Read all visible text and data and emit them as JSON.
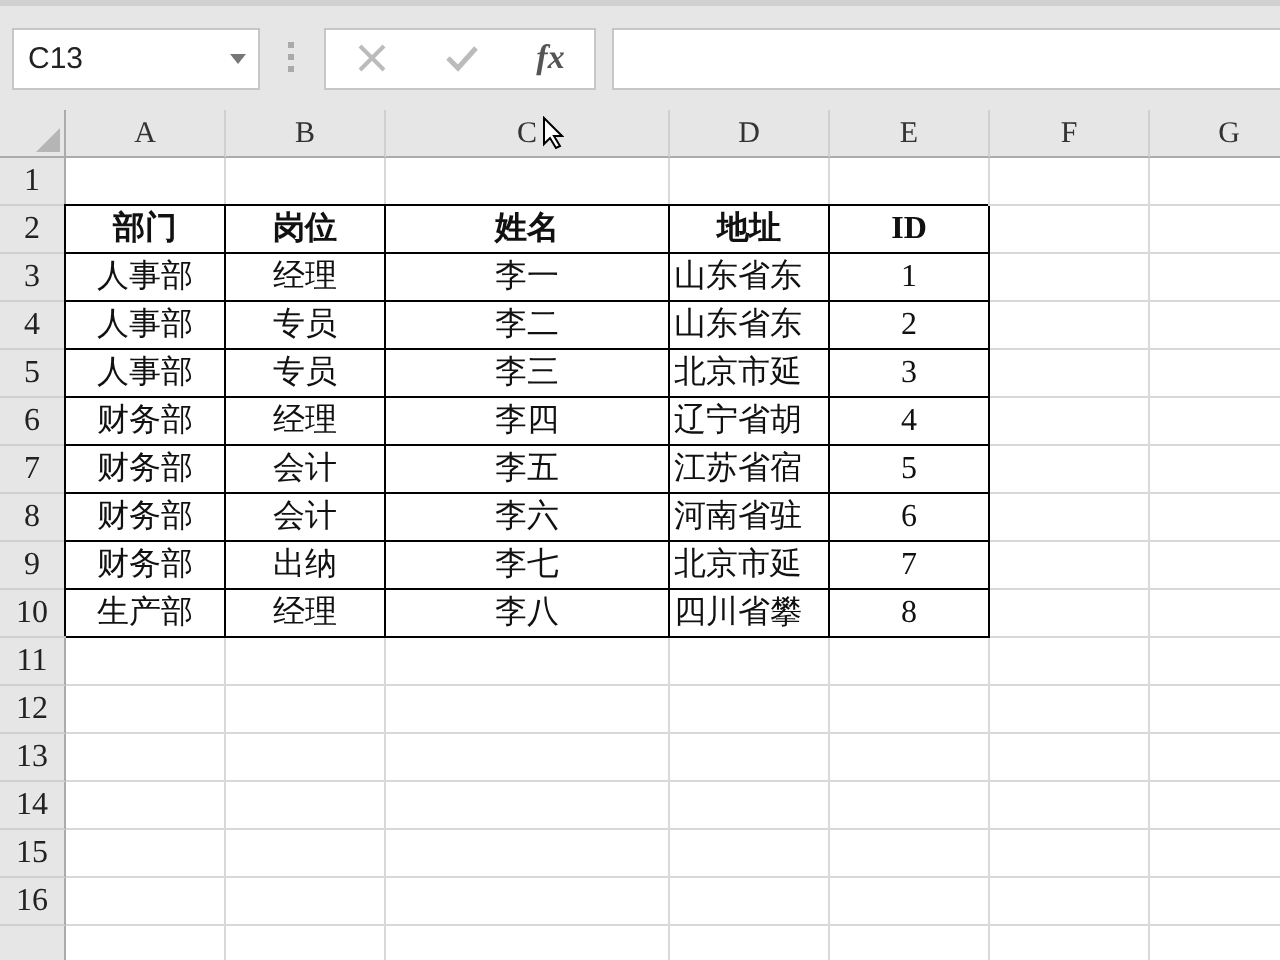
{
  "name_box": {
    "value": "C13"
  },
  "formula_bar": {
    "function_label": "fx"
  },
  "columns": [
    "A",
    "B",
    "C",
    "D",
    "E",
    "F",
    "G"
  ],
  "rows": [
    {
      "number": "1",
      "bordered": false,
      "cells": []
    },
    {
      "number": "2",
      "header": true,
      "bordered": true,
      "cells": [
        "部门",
        "岗位",
        "姓名",
        "地址",
        "ID"
      ]
    },
    {
      "number": "3",
      "header": false,
      "bordered": true,
      "cells": [
        "人事部",
        "经理",
        "李一",
        "山东省东",
        "1"
      ]
    },
    {
      "number": "4",
      "header": false,
      "bordered": true,
      "cells": [
        "人事部",
        "专员",
        "李二",
        "山东省东",
        "2"
      ]
    },
    {
      "number": "5",
      "header": false,
      "bordered": true,
      "cells": [
        "人事部",
        "专员",
        "李三",
        "北京市延",
        "3"
      ]
    },
    {
      "number": "6",
      "header": false,
      "bordered": true,
      "cells": [
        "财务部",
        "经理",
        "李四",
        "辽宁省胡",
        "4"
      ]
    },
    {
      "number": "7",
      "header": false,
      "bordered": true,
      "cells": [
        "财务部",
        "会计",
        "李五",
        "江苏省宿",
        "5"
      ]
    },
    {
      "number": "8",
      "header": false,
      "bordered": true,
      "cells": [
        "财务部",
        "会计",
        "李六",
        "河南省驻",
        "6"
      ]
    },
    {
      "number": "9",
      "header": false,
      "bordered": true,
      "cells": [
        "财务部",
        "出纳",
        "李七",
        "北京市延",
        "7"
      ]
    },
    {
      "number": "10",
      "header": false,
      "bordered": true,
      "cells": [
        "生产部",
        "经理",
        "李八",
        "四川省攀",
        "8"
      ]
    },
    {
      "number": "11",
      "bordered": false,
      "cells": []
    },
    {
      "number": "12",
      "bordered": false,
      "cells": []
    },
    {
      "number": "13",
      "bordered": false,
      "cells": []
    },
    {
      "number": "14",
      "bordered": false,
      "cells": []
    },
    {
      "number": "15",
      "bordered": false,
      "cells": []
    },
    {
      "number": "16",
      "bordered": false,
      "cells": []
    }
  ]
}
